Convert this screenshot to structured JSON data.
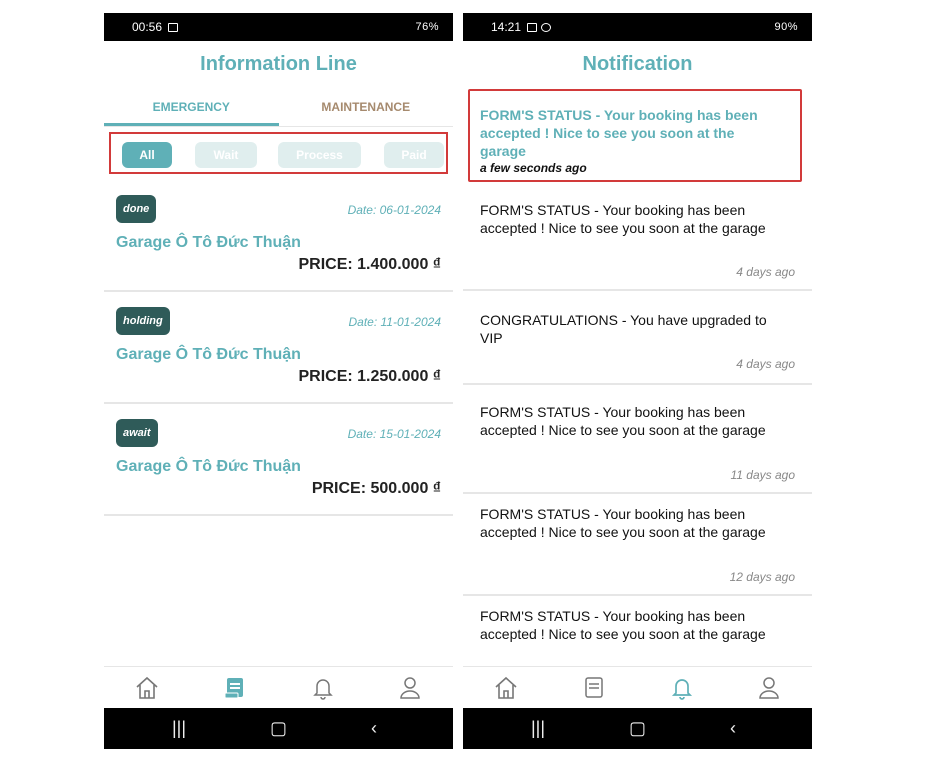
{
  "left": {
    "status": {
      "time": "00:56",
      "system": "76%"
    },
    "title": "Information Line",
    "tabs": [
      "EMERGENCY",
      "MAINTENANCE"
    ],
    "filters": [
      "All",
      "Wait",
      "Process",
      "Paid"
    ],
    "orders": [
      {
        "status": "done",
        "date": "Date: 06-01-2024",
        "garage": "Garage Ô Tô Đức Thuận",
        "price": "PRICE: 1.400.000 ₫"
      },
      {
        "status": "holding",
        "date": "Date: 11-01-2024",
        "garage": "Garage Ô Tô Đức Thuận",
        "price": "PRICE: 1.250.000 ₫"
      },
      {
        "status": "await",
        "date": "Date: 15-01-2024",
        "garage": "Garage Ô Tô Đức Thuận",
        "price": "PRICE: 500.000 ₫"
      }
    ],
    "nav": [
      "home-icon",
      "orders-icon",
      "bell-icon",
      "user-icon"
    ],
    "active_nav": "orders-icon"
  },
  "right": {
    "status": {
      "time": "14:21",
      "system": "90%"
    },
    "title": "Notification",
    "notifications": [
      {
        "text": "FORM'S STATUS - Your booking has been accepted ! Nice to see you soon at the garage",
        "time": "a few seconds ago"
      },
      {
        "text": "FORM'S STATUS - Your booking has been accepted ! Nice to see you soon at the garage",
        "time": "4 days ago"
      },
      {
        "text": "CONGRATULATIONS - You have upgraded to VIP",
        "time": "4 days ago"
      },
      {
        "text": "FORM'S STATUS - Your booking has been accepted ! Nice to see you soon at the garage",
        "time": "11 days ago"
      },
      {
        "text": "FORM'S STATUS - Your booking has been accepted ! Nice to see you soon at the garage",
        "time": "12 days ago"
      },
      {
        "text": "FORM'S STATUS - Your booking has been accepted ! Nice to see you soon at the garage",
        "time": ""
      }
    ],
    "nav": [
      "home-icon",
      "orders-icon",
      "bell-icon",
      "user-icon"
    ],
    "active_nav": "bell-icon"
  },
  "colors": {
    "accent": "#5fb0b7",
    "dark_badge": "#2f5b59",
    "highlight_border": "#d23a3a",
    "tab_inactive": "#a68a6e"
  }
}
